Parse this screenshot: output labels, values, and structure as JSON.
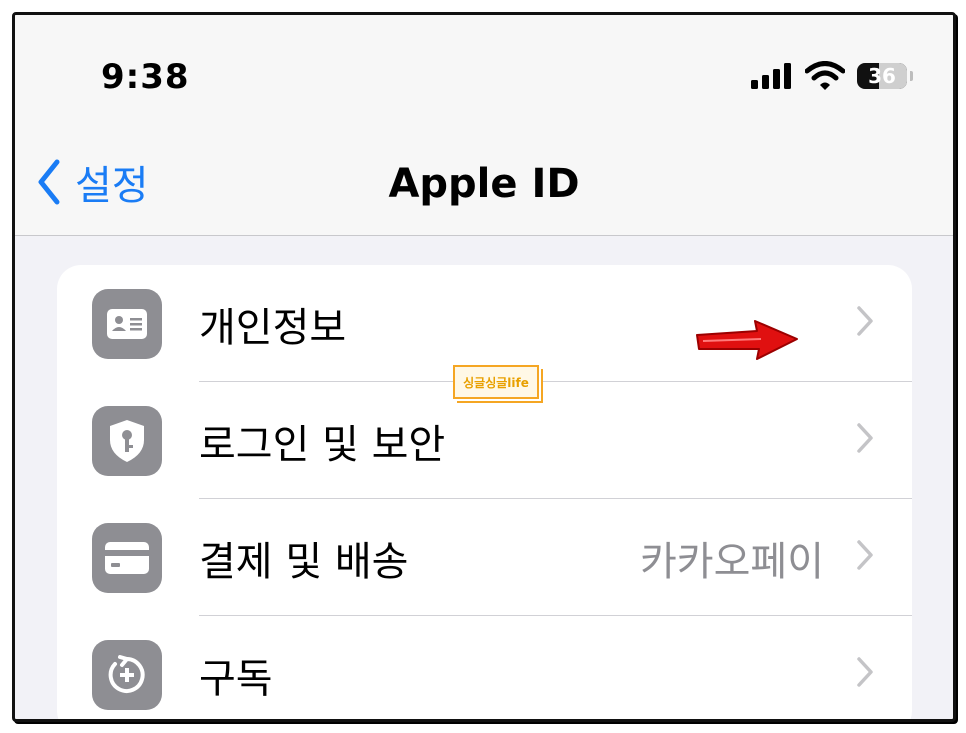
{
  "status_bar": {
    "time": "9:38",
    "battery_level": "36",
    "icons": [
      "cellular-signal-icon",
      "wifi-icon",
      "battery-icon"
    ]
  },
  "nav": {
    "back_label": "설정",
    "title": "Apple ID"
  },
  "rows": [
    {
      "label": "개인정보",
      "value": "",
      "icon": "contact-card-icon"
    },
    {
      "label": "로그인 및 보안",
      "value": "",
      "icon": "shield-key-icon"
    },
    {
      "label": "결제 및 배송",
      "value": "카카오페이",
      "icon": "credit-card-icon"
    },
    {
      "label": "구독",
      "value": "",
      "icon": "subscription-plus-icon"
    }
  ],
  "watermark": "싱글싱글life",
  "colors": {
    "accent": "#1a7cf5",
    "icon_background": "#8e8e93",
    "annotation_arrow": "#e01010"
  }
}
